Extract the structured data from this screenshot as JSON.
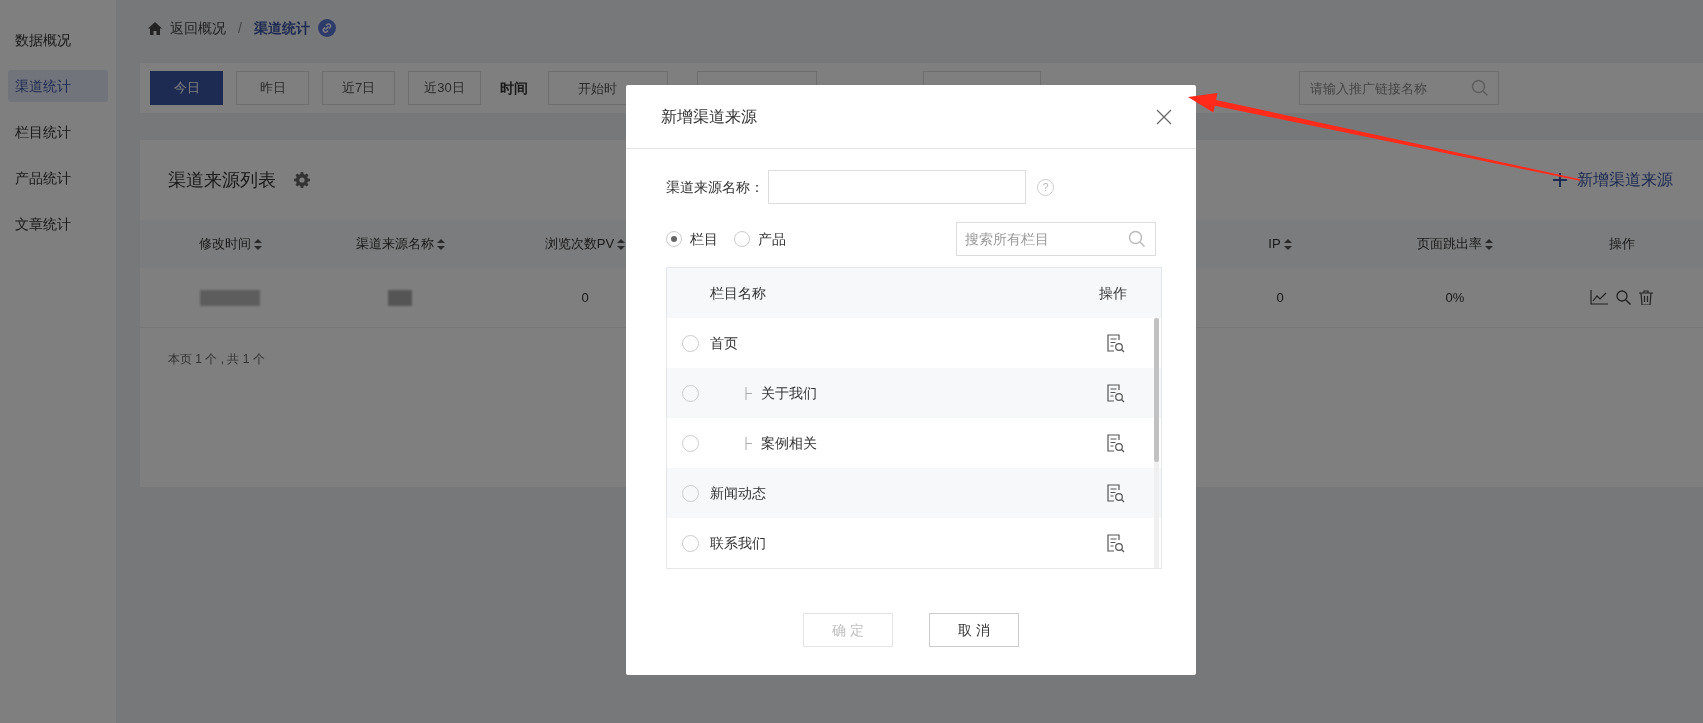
{
  "sidebar": {
    "items": [
      {
        "label": "数据概况",
        "selected": false
      },
      {
        "label": "渠道统计",
        "selected": true
      },
      {
        "label": "栏目统计",
        "selected": false
      },
      {
        "label": "产品统计",
        "selected": false
      },
      {
        "label": "文章统计",
        "selected": false
      }
    ]
  },
  "breadcrumb": {
    "home": "返回概况",
    "separator": "/",
    "current": "渠道统计"
  },
  "filters": {
    "ranges": [
      {
        "label": "今日",
        "selected": true
      },
      {
        "label": "昨日",
        "selected": false
      },
      {
        "label": "近7日",
        "selected": false
      },
      {
        "label": "近30日",
        "selected": false
      }
    ],
    "time_label": "时间",
    "start_placeholder": "开始时",
    "search_placeholder": "请输入推广链接名称"
  },
  "list": {
    "title": "渠道来源列表",
    "add_button": "新增渠道来源",
    "columns": [
      {
        "label": "修改时间",
        "sortable": true
      },
      {
        "label": "渠道来源名称",
        "sortable": true
      },
      {
        "label": "浏览次数PV",
        "sortable": true
      },
      {
        "label": "IP",
        "sortable": true
      },
      {
        "label": "页面跳出率",
        "sortable": true
      },
      {
        "label": "操作",
        "sortable": false
      }
    ],
    "rows": [
      {
        "cells": [
          {
            "kind": "redacted"
          },
          {
            "kind": "redacted"
          },
          {
            "kind": "text",
            "text": "0"
          },
          {
            "kind": "text",
            "text": "0"
          },
          {
            "kind": "text",
            "text": "0%"
          },
          {
            "kind": "actions"
          }
        ]
      }
    ],
    "footer": "本页 1 个 , 共 1 个"
  },
  "dialog": {
    "title": "新增渠道来源",
    "name_label": "渠道来源名称：",
    "help": "?",
    "types": [
      {
        "label": "栏目",
        "selected": true
      },
      {
        "label": "产品",
        "selected": false
      }
    ],
    "search_placeholder": "搜索所有栏目",
    "table": {
      "columns": [
        "栏目名称",
        "操作"
      ],
      "rows": [
        {
          "name": "首页",
          "selected": false,
          "children": [
            {
              "name": "关于我们",
              "selected": false
            },
            {
              "name": "案例相关",
              "selected": false
            }
          ]
        },
        {
          "name": "新闻动态",
          "selected": false
        },
        {
          "name": "联系我们",
          "selected": false
        }
      ]
    },
    "buttons": [
      {
        "label": "确 定",
        "disabled": true
      },
      {
        "label": "取 消",
        "disabled": false
      }
    ]
  }
}
